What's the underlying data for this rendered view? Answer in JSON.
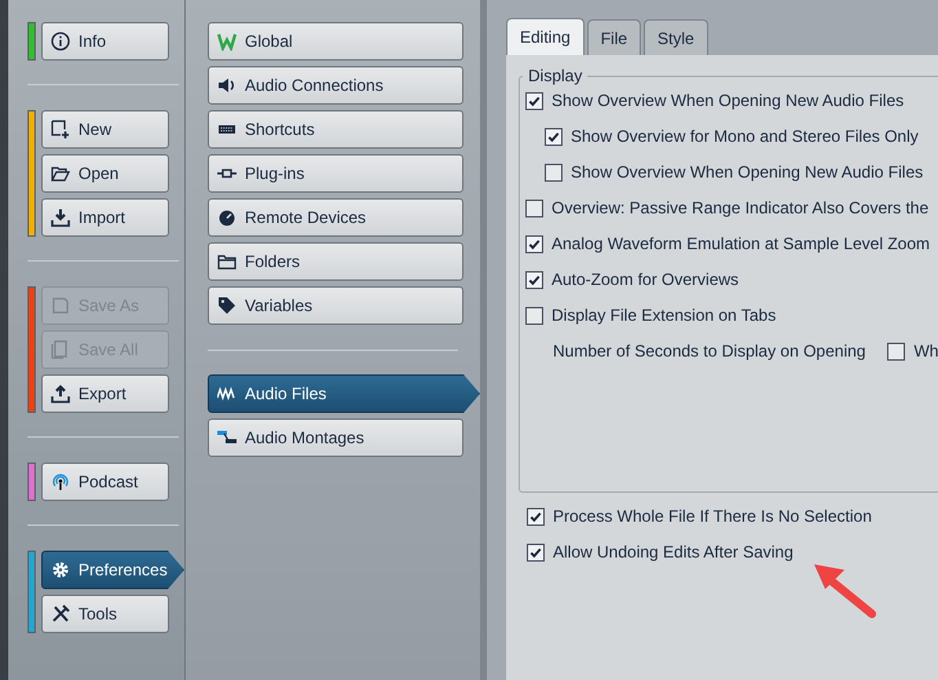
{
  "sidebar": {
    "groups": [
      {
        "color": "#2fbf2f",
        "items": [
          {
            "label": "Info",
            "disabled": false,
            "selected": false
          }
        ]
      },
      {
        "color": "#f0b000",
        "items": [
          {
            "label": "New",
            "disabled": false,
            "selected": false
          },
          {
            "label": "Open",
            "disabled": false,
            "selected": false
          },
          {
            "label": "Import",
            "disabled": false,
            "selected": false
          }
        ]
      },
      {
        "color": "#f04010",
        "items": [
          {
            "label": "Save As",
            "disabled": true,
            "selected": false
          },
          {
            "label": "Save All",
            "disabled": true,
            "selected": false
          },
          {
            "label": "Export",
            "disabled": false,
            "selected": false
          }
        ]
      },
      {
        "color": "#e070d0",
        "items": [
          {
            "label": "Podcast",
            "disabled": false,
            "selected": false
          }
        ]
      },
      {
        "color": "#20a8d0",
        "items": [
          {
            "label": "Preferences",
            "disabled": false,
            "selected": true
          },
          {
            "label": "Tools",
            "disabled": false,
            "selected": false
          }
        ]
      }
    ]
  },
  "categories": {
    "groups": [
      [
        {
          "label": "Global",
          "selected": false
        },
        {
          "label": "Audio Connections",
          "selected": false
        },
        {
          "label": "Shortcuts",
          "selected": false
        },
        {
          "label": "Plug-ins",
          "selected": false
        },
        {
          "label": "Remote Devices",
          "selected": false
        },
        {
          "label": "Folders",
          "selected": false
        },
        {
          "label": "Variables",
          "selected": false
        }
      ],
      [
        {
          "label": "Audio Files",
          "selected": true
        },
        {
          "label": "Audio Montages",
          "selected": false
        }
      ]
    ]
  },
  "tabs": [
    {
      "label": "Editing",
      "selected": true
    },
    {
      "label": "File",
      "selected": false
    },
    {
      "label": "Style",
      "selected": false
    }
  ],
  "display_group": {
    "title": "Display",
    "options": [
      {
        "label": "Show Overview When Opening New Audio Files",
        "checked": true,
        "children": [
          {
            "label": "Show Overview for Mono and Stereo Files Only",
            "checked": true
          },
          {
            "label": "Show Overview When Opening New Audio Files",
            "checked": false
          }
        ]
      },
      {
        "label": "Overview: Passive Range Indicator Also Covers the",
        "checked": false
      },
      {
        "label": "Analog Waveform Emulation at Sample Level Zoom",
        "checked": true
      },
      {
        "label": "Auto-Zoom for Overviews",
        "checked": true
      },
      {
        "label": "Display File Extension on Tabs",
        "checked": false
      }
    ],
    "seconds": {
      "label": "Number of Seconds to Display on Opening",
      "option": {
        "label": "Wh",
        "checked": false
      }
    }
  },
  "options": [
    {
      "label": "Process Whole File If There Is No Selection",
      "checked": true
    },
    {
      "label": "Allow Undoing Edits After Saving",
      "checked": true
    }
  ]
}
